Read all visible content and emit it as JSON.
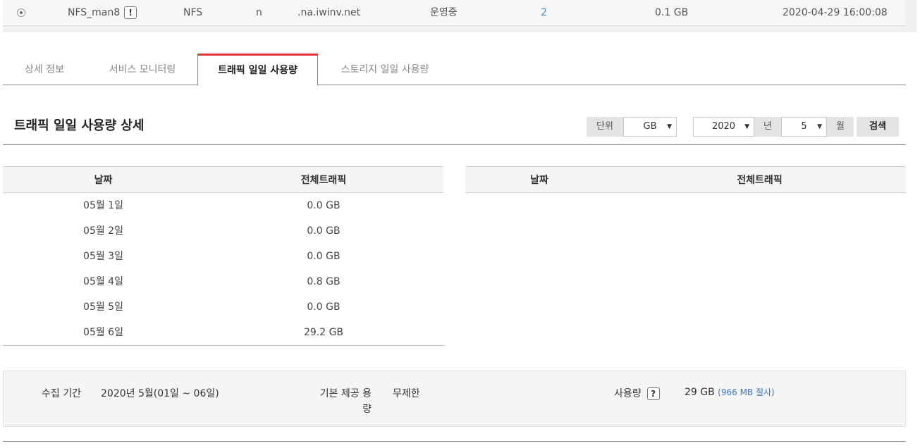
{
  "server_row": {
    "name": "NFS_man8",
    "warn_badge": "!",
    "type": "NFS",
    "flag": "n",
    "host": ".na.iwinv.net",
    "status": "운영중",
    "count": "2",
    "size": "0.1 GB",
    "created": "2020-04-29 16:00:08"
  },
  "tabs": [
    {
      "label": "상세 정보"
    },
    {
      "label": "서비스 모니터링"
    },
    {
      "label": "트래픽 일일 사용량"
    },
    {
      "label": "스토리지 일일 사용량"
    }
  ],
  "section": {
    "title": "트래픽 일일 사용량 상세"
  },
  "filters": {
    "unit_label": "단위",
    "unit_value": "GB",
    "year_value": "2020",
    "year_label": "년",
    "month_value": "5",
    "month_label": "월",
    "search_label": "검색"
  },
  "table": {
    "headers": [
      "날짜",
      "전체트래픽"
    ],
    "rows": [
      [
        "05월 1일",
        "0.0 GB"
      ],
      [
        "05월 2일",
        "0.0 GB"
      ],
      [
        "05월 3일",
        "0.0 GB"
      ],
      [
        "05월 4일",
        "0.8 GB"
      ],
      [
        "05월 5일",
        "0.0 GB"
      ],
      [
        "05월 6일",
        "29.2 GB"
      ]
    ]
  },
  "table2": {
    "headers": [
      "날짜",
      "전체트래픽"
    ]
  },
  "info": {
    "period_label": "수집 기간",
    "period_value": "2020년 5월(01일 ~ 06일)",
    "quota_label_1": "기본 제공 용",
    "quota_label_2": "량",
    "quota_value": "무제한",
    "usage_label": "사용량",
    "usage_help": "?",
    "usage_value": "29 GB",
    "usage_note": "(966 MB 절사)"
  }
}
